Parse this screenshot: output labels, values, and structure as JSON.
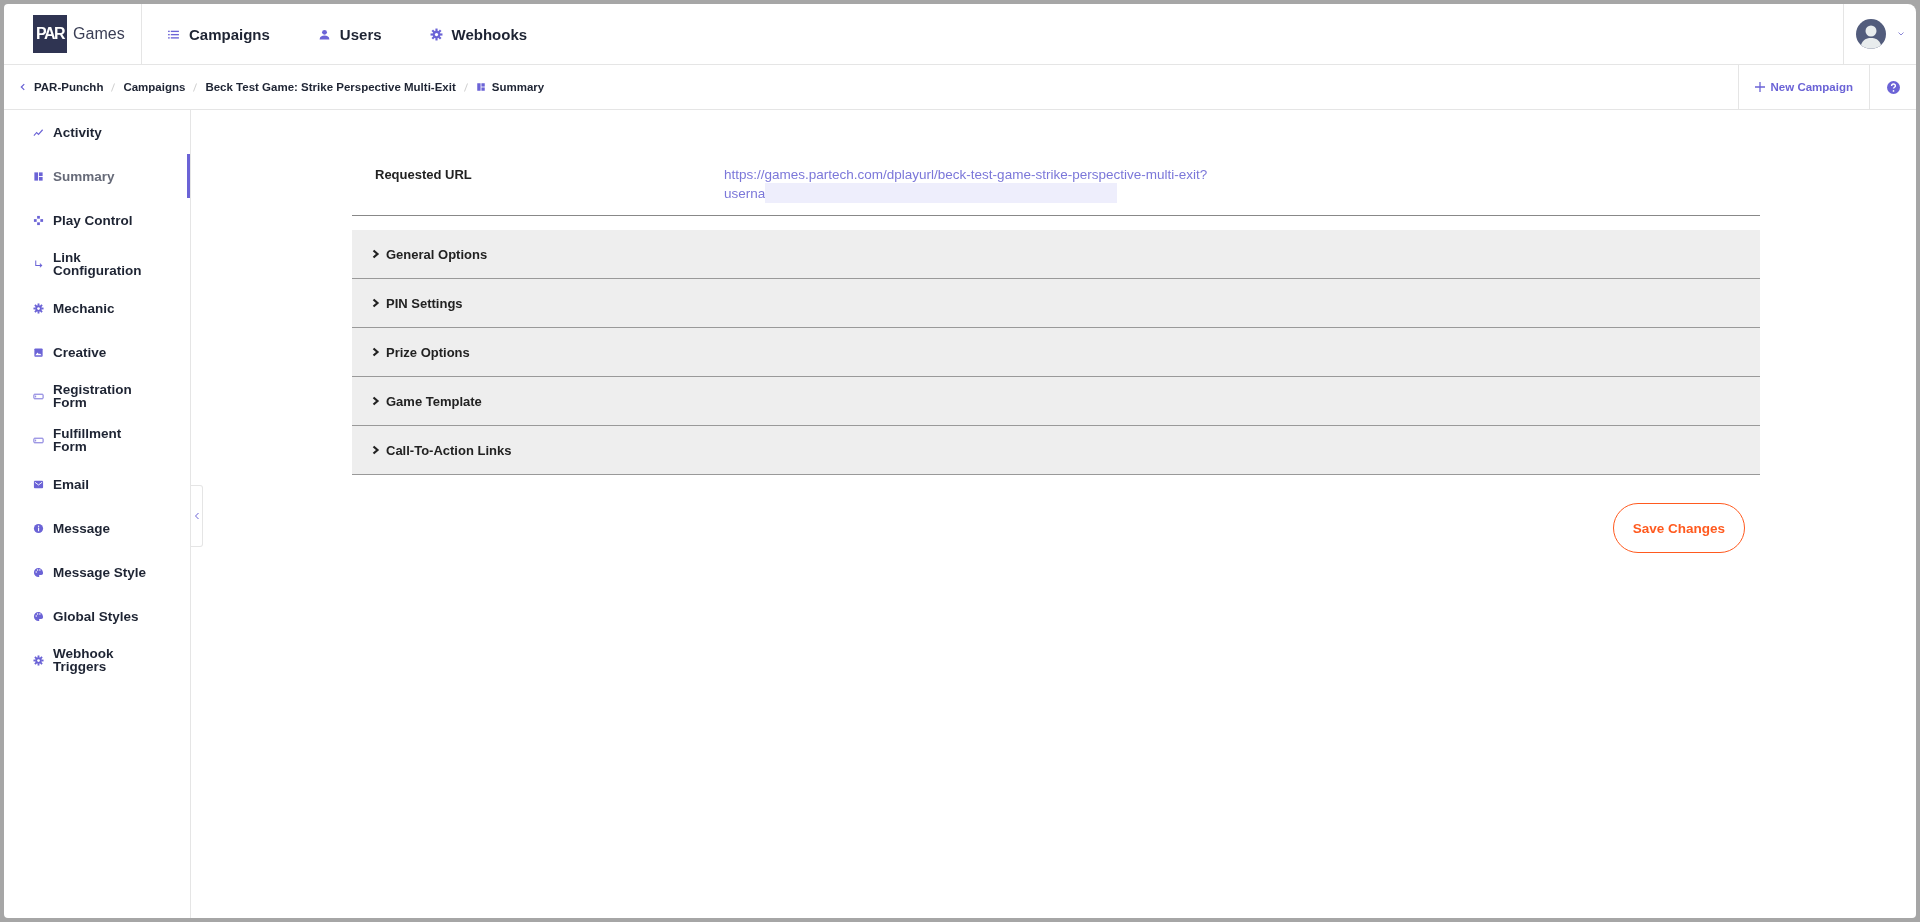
{
  "logo": {
    "mark": "PAR",
    "text": "Games"
  },
  "nav": [
    {
      "label": "Campaigns"
    },
    {
      "label": "Users"
    },
    {
      "label": "Webhooks"
    }
  ],
  "breadcrumb": [
    {
      "label": "PAR-Punchh"
    },
    {
      "label": "Campaigns"
    },
    {
      "label": "Beck Test Game: Strike Perspective Multi-Exit"
    },
    {
      "label": "Summary"
    }
  ],
  "toolbar": {
    "new_button": "New Campaign"
  },
  "sidebar": {
    "items": [
      {
        "label": "Activity",
        "selected": false
      },
      {
        "label": "Summary",
        "selected": true
      },
      {
        "label": "Play Control",
        "selected": false
      },
      {
        "label": "Link Configuration",
        "selected": false
      },
      {
        "label": "Mechanic",
        "selected": false
      },
      {
        "label": "Creative",
        "selected": false
      },
      {
        "label": "Registration Form",
        "selected": false
      },
      {
        "label": "Fulfillment Form",
        "selected": false
      },
      {
        "label": "Email",
        "selected": false
      },
      {
        "label": "Message",
        "selected": false
      },
      {
        "label": "Message Style",
        "selected": false
      },
      {
        "label": "Global Styles",
        "selected": false
      },
      {
        "label": "Webhook Triggers",
        "selected": false
      }
    ]
  },
  "requested_url": {
    "label": "Requested URL",
    "value_lines": [
      "https://games.partech.com/dplayurl/beck-test-game-strike-perspective-multi-exit?",
      "userna"
    ],
    "redacted": true
  },
  "sections": [
    {
      "title": "General Options",
      "expanded": false
    },
    {
      "title": "PIN Settings",
      "expanded": false
    },
    {
      "title": "Prize Options",
      "expanded": false
    },
    {
      "title": "Game Template",
      "expanded": false
    },
    {
      "title": "Call-To-Action Links",
      "expanded": false
    }
  ],
  "save_button": "Save Changes"
}
